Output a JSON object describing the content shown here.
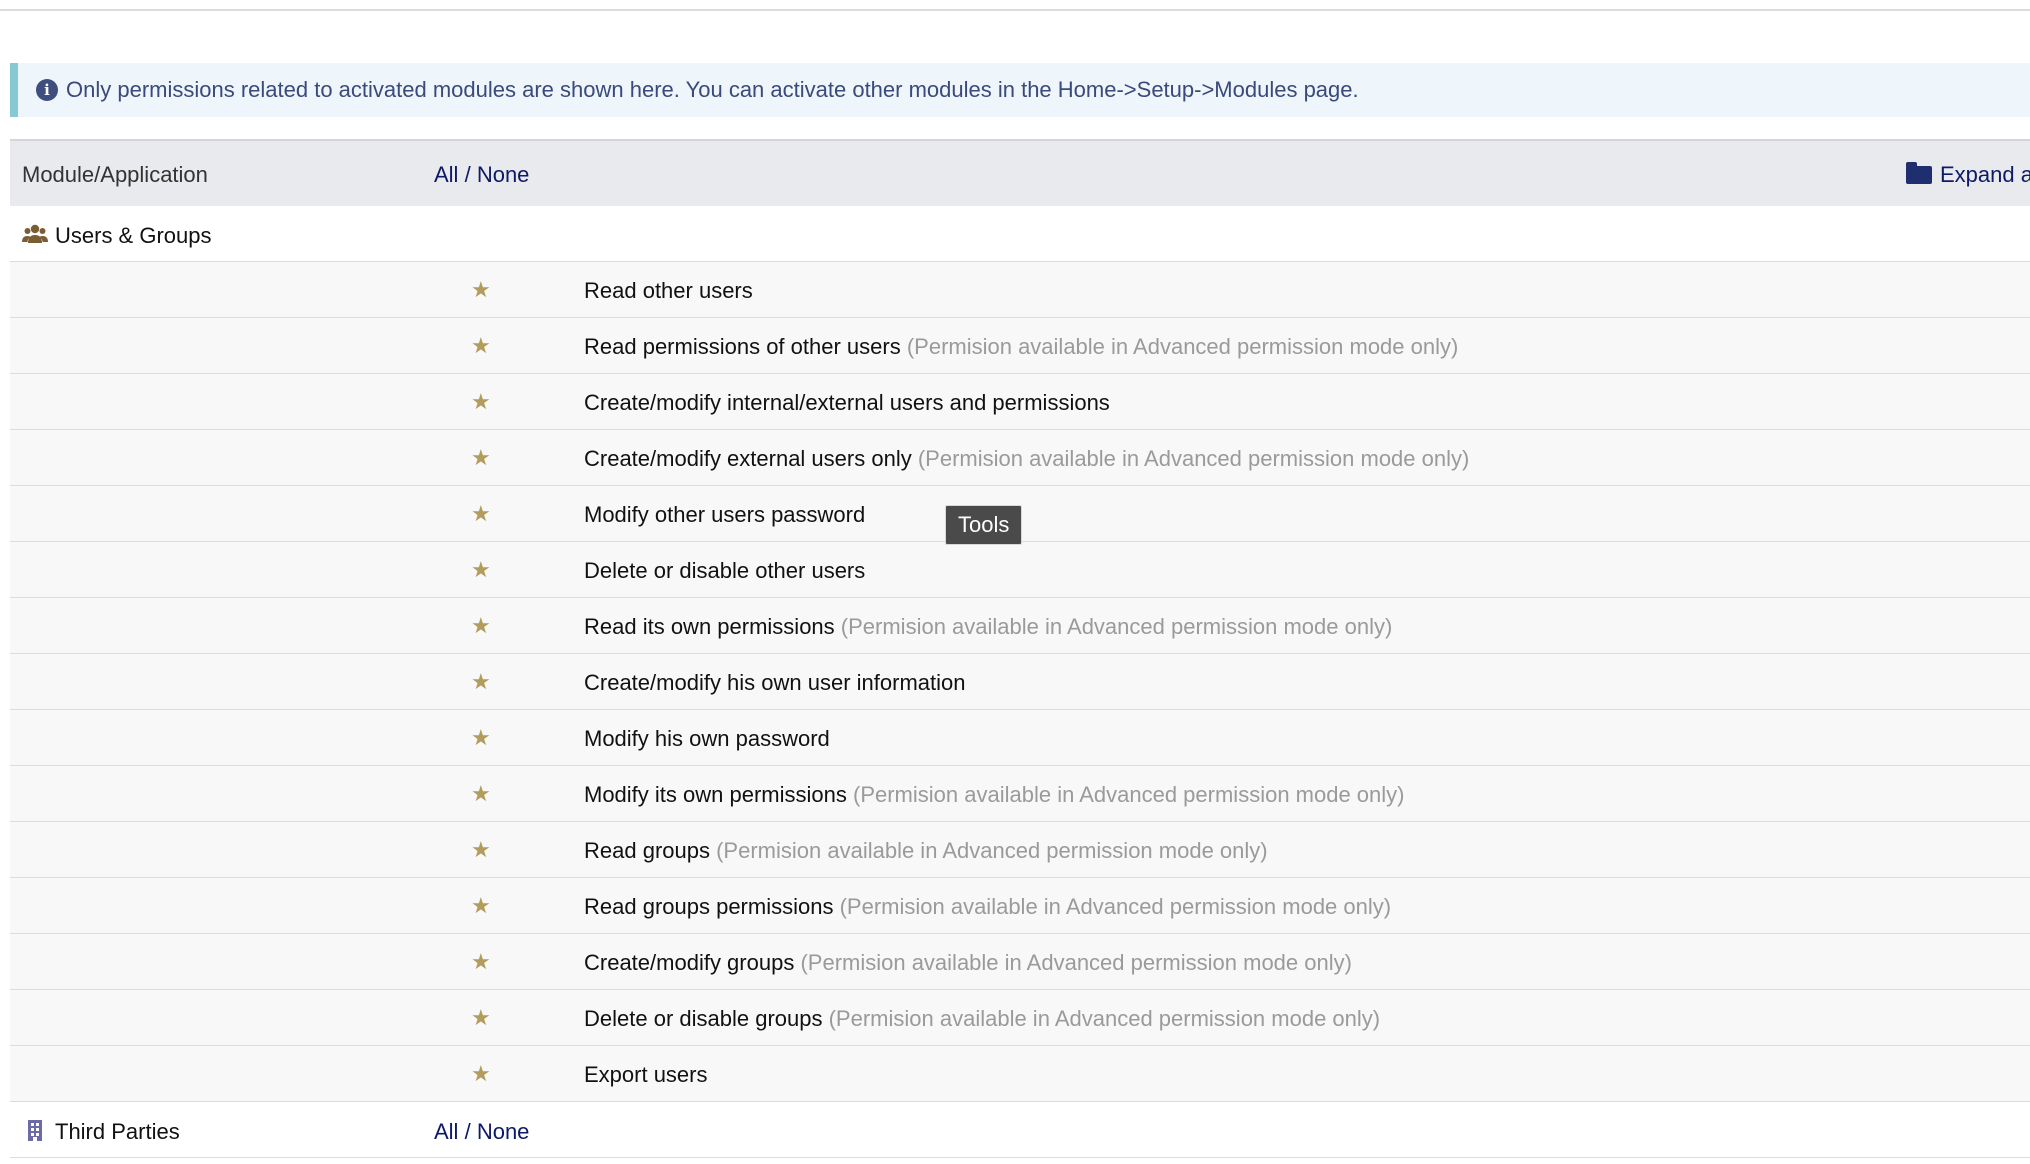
{
  "info": {
    "icon": "info-icon",
    "message": "Only permissions related to activated modules are shown here. You can activate other modules in the Home->Setup->Modules page."
  },
  "header": {
    "module_col": "Module/Application",
    "all": "All",
    "sep": "/",
    "none": "None",
    "expand_label": "Expand a"
  },
  "modules": [
    {
      "label": "Users & Groups",
      "icon": "users-icon"
    },
    {
      "label": "Third Parties",
      "icon": "building-icon",
      "all": "All",
      "sep": "/",
      "none": "None"
    }
  ],
  "permissions": [
    {
      "label": "Read other users",
      "note": ""
    },
    {
      "label": "Read permissions of other users",
      "note": "(Permision available in Advanced permission mode only)"
    },
    {
      "label": "Create/modify internal/external users and permissions",
      "note": ""
    },
    {
      "label": "Create/modify external users only",
      "note": "(Permision available in Advanced permission mode only)"
    },
    {
      "label": "Modify other users password",
      "note": ""
    },
    {
      "label": "Delete or disable other users",
      "note": ""
    },
    {
      "label": "Read its own permissions",
      "note": "(Permision available in Advanced permission mode only)"
    },
    {
      "label": "Create/modify his own user information",
      "note": ""
    },
    {
      "label": "Modify his own password",
      "note": ""
    },
    {
      "label": "Modify its own permissions",
      "note": "(Permision available in Advanced permission mode only)"
    },
    {
      "label": "Read groups",
      "note": "(Permision available in Advanced permission mode only)"
    },
    {
      "label": "Read groups permissions",
      "note": "(Permision available in Advanced permission mode only)"
    },
    {
      "label": "Create/modify groups",
      "note": "(Permision available in Advanced permission mode only)"
    },
    {
      "label": "Delete or disable groups",
      "note": "(Permision available in Advanced permission mode only)"
    },
    {
      "label": "Export users",
      "note": ""
    }
  ],
  "tooltip": {
    "text": "Tools"
  },
  "colors": {
    "link": "#0d1a66",
    "star": "#b39b5c",
    "note": "#9a9a9a",
    "info_border": "#86c9d3",
    "info_bg": "#eef5fb"
  }
}
